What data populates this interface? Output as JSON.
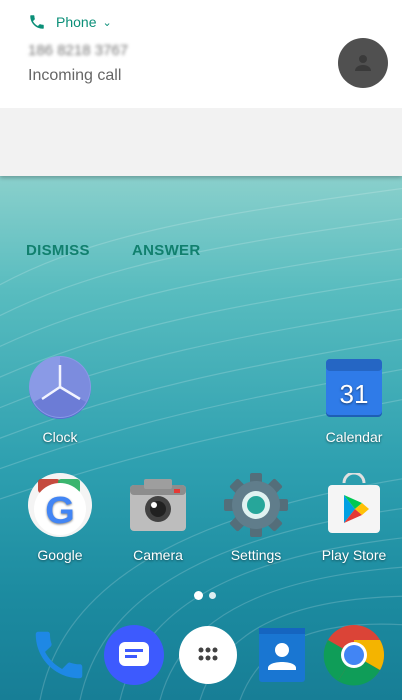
{
  "notification": {
    "app_name": "Phone",
    "caller_number": "186 8218 3767",
    "status_text": "Incoming call",
    "actions": {
      "dismiss": "DISMISS",
      "answer": "ANSWER"
    },
    "accent_color": "#0b8f78"
  },
  "home": {
    "row1": [
      {
        "label": "Clock",
        "icon": "clock-icon"
      },
      {
        "label": "Calendar",
        "icon": "calendar-icon",
        "badge": "31"
      }
    ],
    "row2": [
      {
        "label": "Google",
        "icon": "google-icon"
      },
      {
        "label": "Camera",
        "icon": "camera-icon"
      },
      {
        "label": "Settings",
        "icon": "settings-icon"
      },
      {
        "label": "Play Store",
        "icon": "play-store-icon"
      }
    ],
    "page_indicator": {
      "pages": 2,
      "current": 1
    }
  },
  "dock": [
    {
      "icon": "phone-icon"
    },
    {
      "icon": "messages-icon"
    },
    {
      "icon": "app-drawer-icon"
    },
    {
      "icon": "contacts-icon"
    },
    {
      "icon": "chrome-icon"
    }
  ]
}
